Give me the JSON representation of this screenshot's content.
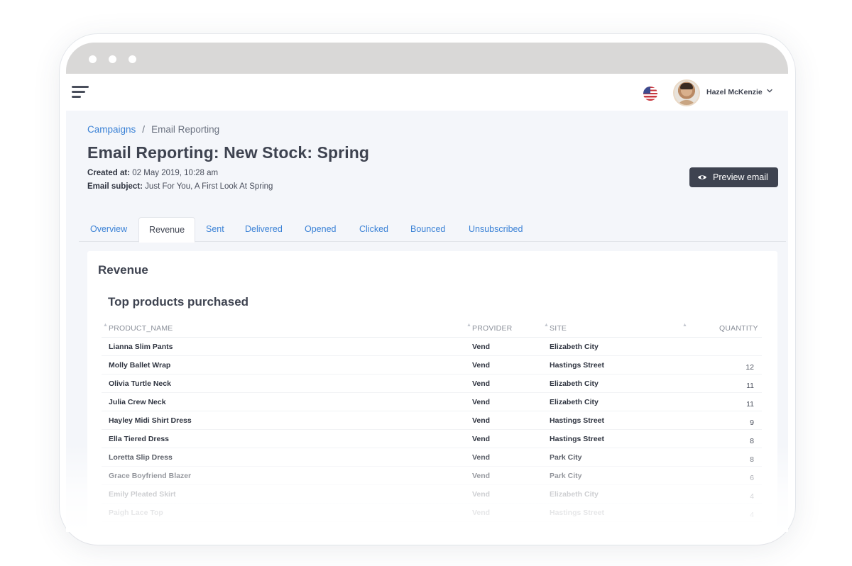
{
  "app": {
    "user_name": "Hazel McKenzie",
    "locale_flag": "us-flag-icon"
  },
  "breadcrumb": {
    "root": "Campaigns",
    "separator": "/",
    "current": "Email Reporting"
  },
  "page": {
    "title": "Email Reporting: New Stock: Spring",
    "created_label": "Created at:",
    "created_value": "02 May 2019, 10:28 am",
    "subject_label": "Email subject:",
    "subject_value": "Just For You, A First Look At Spring",
    "preview_button": "Preview email"
  },
  "tabs": [
    {
      "label": "Overview",
      "active": false
    },
    {
      "label": "Revenue",
      "active": true
    },
    {
      "label": "Sent",
      "active": false
    },
    {
      "label": "Delivered",
      "active": false
    },
    {
      "label": "Opened",
      "active": false
    },
    {
      "label": "Clicked",
      "active": false
    },
    {
      "label": "Bounced",
      "active": false
    },
    {
      "label": "Unsubscribed",
      "active": false
    }
  ],
  "revenue": {
    "card_title": "Revenue",
    "section_title": "Top products purchased",
    "columns": [
      "PRODUCT_NAME",
      "PROVIDER",
      "SITE",
      "QUANTITY"
    ],
    "rows": [
      {
        "product": "Lianna Slim Pants",
        "provider": "Vend",
        "site": "Elizabeth City",
        "quantity": ""
      },
      {
        "product": "Molly Ballet Wrap",
        "provider": "Vend",
        "site": "Hastings Street",
        "quantity": "12"
      },
      {
        "product": "Olivia Turtle Neck",
        "provider": "Vend",
        "site": "Elizabeth City",
        "quantity": "11"
      },
      {
        "product": "Julia Crew Neck",
        "provider": "Vend",
        "site": "Elizabeth City",
        "quantity": "11"
      },
      {
        "product": "Hayley Midi Shirt Dress",
        "provider": "Vend",
        "site": "Hastings Street",
        "quantity": "9"
      },
      {
        "product": "Ella Tiered Dress",
        "provider": "Vend",
        "site": "Hastings Street",
        "quantity": "8"
      },
      {
        "product": "Loretta Slip Dress",
        "provider": "Vend",
        "site": "Park City",
        "quantity": "8"
      },
      {
        "product": "Grace Boyfriend Blazer",
        "provider": "Vend",
        "site": "Park City",
        "quantity": "6"
      },
      {
        "product": "Emily Pleated Skirt",
        "provider": "Vend",
        "site": "Elizabeth City",
        "quantity": "4"
      },
      {
        "product": "Paigh Lace Top",
        "provider": "Vend",
        "site": "Hastings Street",
        "quantity": "4"
      }
    ]
  },
  "colors": {
    "accent": "#3b82d6",
    "dark": "#3e4350",
    "titlebar": "#d9d8d7",
    "background": "#f4f6fa"
  }
}
